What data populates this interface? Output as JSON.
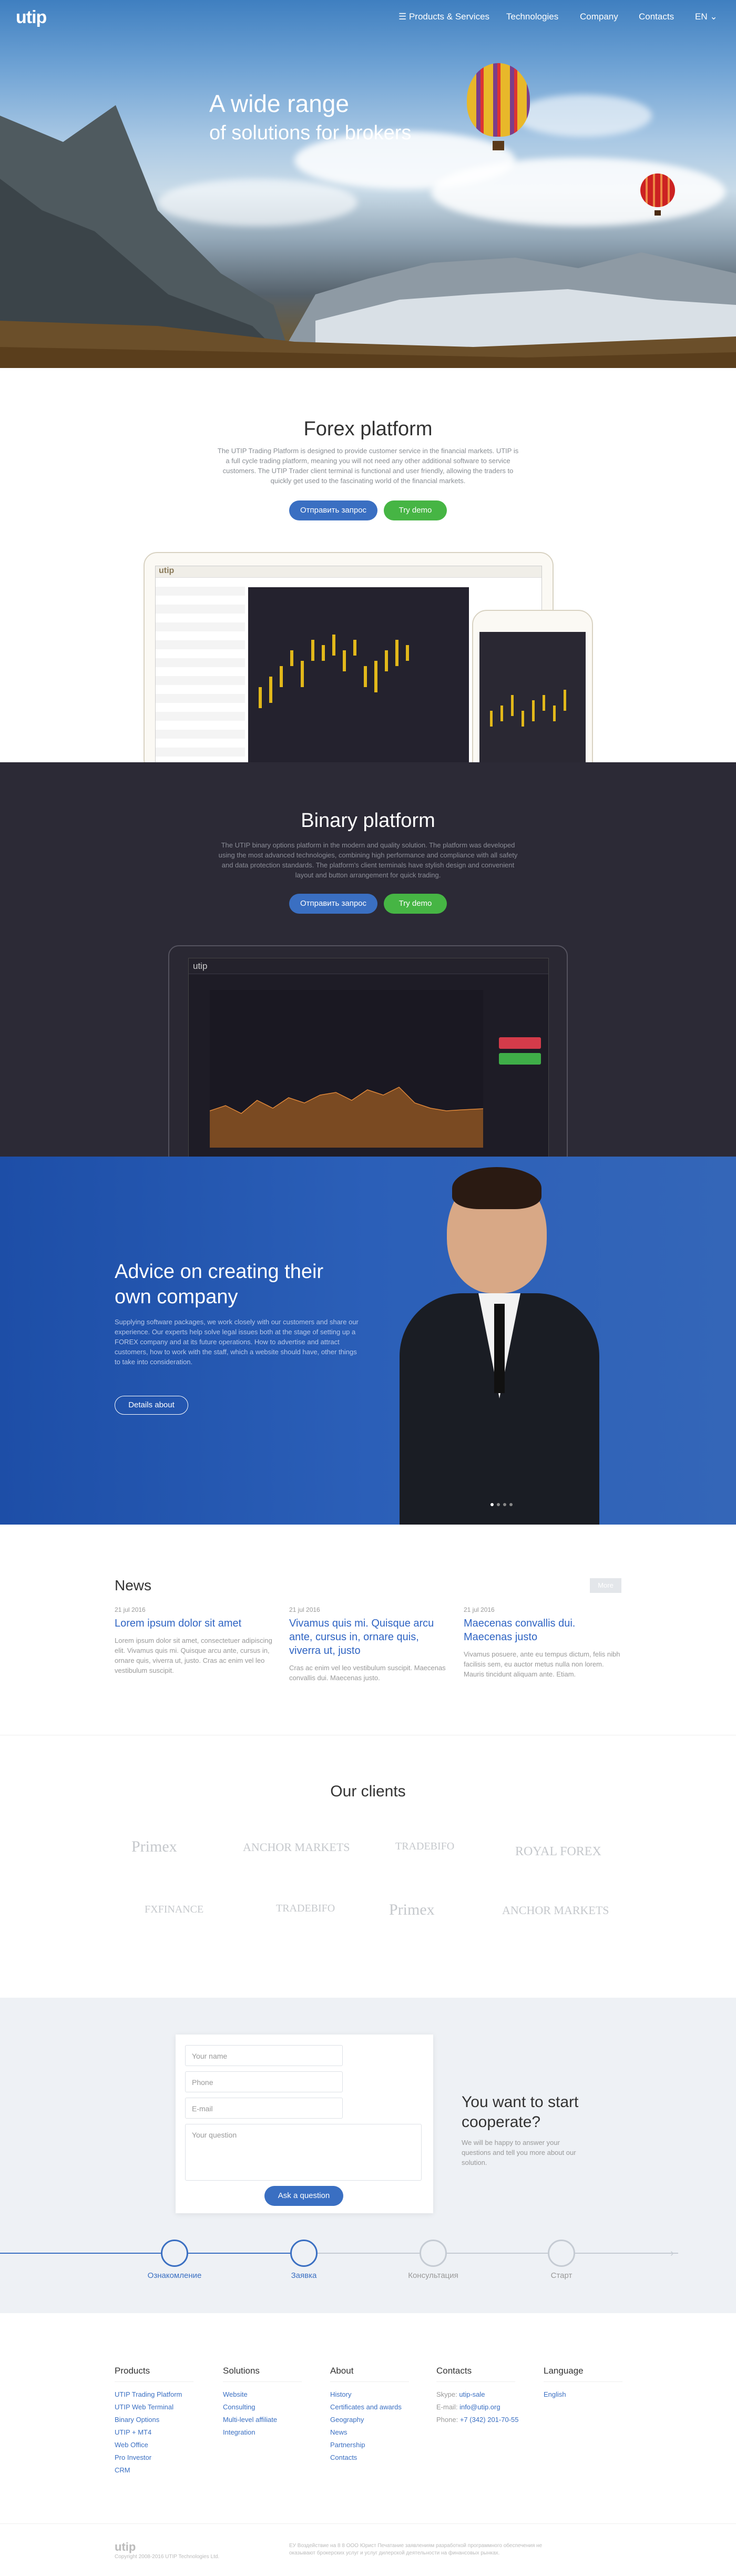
{
  "brand": "utip",
  "nav": {
    "products": "Products & Services",
    "technologies": "Technologies",
    "company": "Company",
    "contacts": "Contacts",
    "lang": "EN"
  },
  "hero": {
    "title": "A wide range",
    "subtitle": "of solutions for brokers"
  },
  "forex": {
    "title": "Forex platform",
    "text": "The UTIP Trading Platform is designed to provide customer service in the financial markets. UTIP is a full cycle trading platform, meaning you will not need any other additional software to service customers. The UTIP Trader client terminal is functional and user friendly, allowing the traders to quickly get used to the fascinating world of the financial markets.",
    "btn_request": "Отправить запрос",
    "btn_demo": "Try demo"
  },
  "binary": {
    "title": "Binary platform",
    "text": "The UTIP binary options platform in the modern and quality solution. The platform was developed using the most advanced technologies, combining high performance and compliance with all safety and data protection standards. The platform's client terminals have stylish design and convenient layout and button arrangement for quick trading.",
    "btn_request": "Отправить запрос",
    "btn_demo": "Try demo"
  },
  "advice": {
    "title": "Advice on creating their own company",
    "text": "Supplying software packages, we work closely with our customers and share our experience. Our experts help solve legal issues both at the stage of setting up a FOREX company and at its future operations. How to advertise and attract customers, how to work with the staff, which a website should have, other things to take into consideration.",
    "btn": "Details about"
  },
  "news": {
    "title": "News",
    "more": "More",
    "items": [
      {
        "date": "21 jul 2016",
        "title": "Lorem ipsum dolor sit amet",
        "text": "Lorem ipsum dolor sit amet, consectetuer adipiscing elit. Vivamus quis mi. Quisque arcu ante, cursus in, ornare quis, viverra ut, justo. Cras ac enim vel leo vestibulum suscipit."
      },
      {
        "date": "21 jul 2016",
        "title": "Vivamus quis mi. Quisque arcu ante, cursus in, ornare quis, viverra ut, justo",
        "text": "Cras ac enim vel leo vestibulum suscipit. Maecenas convallis dui. Maecenas justo."
      },
      {
        "date": "21 jul 2016",
        "title": "Maecenas convallis dui. Maecenas justo",
        "text": "Vivamus posuere, ante eu tempus dictum, felis nibh facilisis sem, eu auctor metus nulla non lorem. Mauris tincidunt aliquam ante. Etiam."
      }
    ]
  },
  "clients": {
    "title": "Our clients",
    "logos": [
      "Primex",
      "ANCHOR MARKETS",
      "TRADEBIFO",
      "ROYAL FOREX",
      "FXFINANCE",
      "TRADEBIFO",
      "Primex",
      "ANCHOR MARKETS"
    ]
  },
  "contact": {
    "name_ph": "Your name",
    "phone_ph": "Phone",
    "email_ph": "E-mail",
    "question_ph": "Your question",
    "btn": "Ask a question",
    "title": "You want to start cooperate?",
    "text": "We will be happy to answer your questions and tell you more about our solution.",
    "steps": [
      "Ознакомление",
      "Заявка",
      "Консультация",
      "Старт"
    ]
  },
  "footer": {
    "products": {
      "title": "Products",
      "items": [
        "UTIP Trading Platform",
        "UTIP Web Terminal",
        "Binary Options",
        "UTIP + MT4",
        "Web Office",
        "Pro Investor",
        "CRM"
      ]
    },
    "solutions": {
      "title": "Solutions",
      "items": [
        "Website",
        "Consulting",
        "Multi-level affiliate",
        "Integration"
      ]
    },
    "about": {
      "title": "About",
      "items": [
        "History",
        "Certificates and awards",
        "Geography",
        "News",
        "Partnership",
        "Contacts"
      ]
    },
    "contacts": {
      "title": "Contacts",
      "skype_label": "Skype:",
      "skype": "utip-sale",
      "email_label": "E-mail:",
      "email": "info@utip.org",
      "phone_label": "Phone:",
      "phone": "+7 (342) 201-70-55"
    },
    "language": {
      "title": "Language",
      "value": "English"
    },
    "copyright": "Copyright 2008-2016 UTIP Technologies Ltd.",
    "legal": "ЕУ Воздействие на 8 8 ООО Юрист Печатание заявлениям разработкой программного обеспечения не оказывают брокерских услуг и услуг дилерской деятельности на финансовых рынках."
  }
}
